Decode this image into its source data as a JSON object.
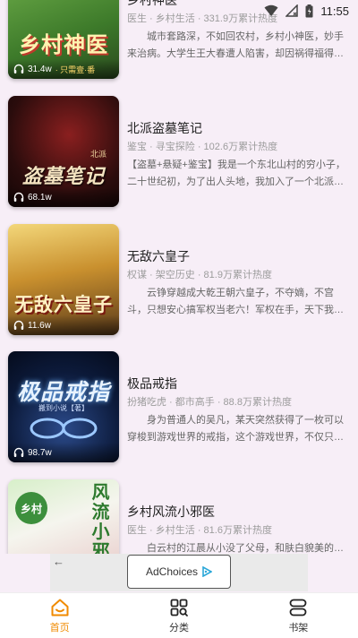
{
  "status_bar": {
    "time": "11:55"
  },
  "books": [
    {
      "title": "乡村神医",
      "meta": "医生 · 乡村生活 · 331.9万累计热度",
      "desc": "城市套路深，不如回农村，乡村小神医，妙手来治病。大学生王大春遭人陷害，却因祸得福得到传承，从此在乡村过上了逍遥快活的日子。",
      "plays": "31.4w",
      "cover_text": "乡村神医",
      "cover_sub": "· 只需壹·番"
    },
    {
      "title": "北派盗墓笔记",
      "meta": "鉴宝 · 寻宝探险 · 102.6万累计热度",
      "desc": "【盗墓+悬疑+鉴宝】我是一个东北山村的穷小子，二十世纪初，为了出人头地，我加入了一个北派盗墓团伙。",
      "plays": "68.1w",
      "cover_text": "盗墓笔记",
      "cover_sub": "北派"
    },
    {
      "title": "无敌六皇子",
      "meta": "权谋 · 架空历史 · 81.9万累计热度",
      "desc": "云铮穿越成大乾王朝六皇子，不夺嫡，不宫斗，只想安心搞军权当老六！军权在手，天下我有！",
      "plays": "11.6w",
      "cover_text": "无敌六皇子",
      "cover_sub": ""
    },
    {
      "title": "极品戒指",
      "meta": "扮猪吃虎 · 都市高手 · 88.8万累计热度",
      "desc": "身为普通人的吴凡，某天突然获得了一枚可以穿梭到游戏世界的戒指，这个游戏世界，不仅只有打怪升级。",
      "plays": "98.7w",
      "cover_text": "极品戒指",
      "cover_sub": "搬到小说【著】"
    },
    {
      "title": "乡村风流小邪医",
      "meta": "医生 · 乡村生活 · 81.6万累计热度",
      "desc": "白云村的江晨从小没了父母，和肤白貌美的婶子相依为命，一次意外让他获得神秘传承。",
      "plays": "",
      "cover_text": "风流小邪",
      "cover_sub": "乡村"
    }
  ],
  "ad": {
    "back": "←",
    "label": "AdChoices"
  },
  "nav": [
    {
      "label": "首页",
      "icon": "home-icon",
      "active": true
    },
    {
      "label": "分类",
      "icon": "category-icon",
      "active": false
    },
    {
      "label": "书架",
      "icon": "bookshelf-icon",
      "active": false
    }
  ],
  "colors": {
    "accent": "#f08a00",
    "background": "#f7eef7"
  }
}
